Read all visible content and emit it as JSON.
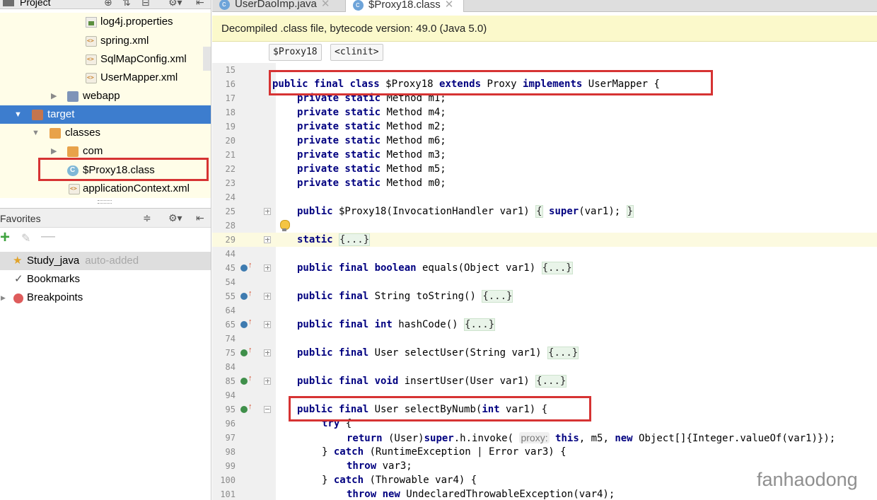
{
  "project_panel": {
    "title": "Project",
    "tree": [
      {
        "label": "log4j.properties",
        "icon": "properties-file-icon"
      },
      {
        "label": "spring.xml",
        "icon": "xml-file-icon"
      },
      {
        "label": "SqlMapConfig.xml",
        "icon": "xml-file-icon"
      },
      {
        "label": "UserMapper.xml",
        "icon": "xml-file-icon"
      },
      {
        "label": "webapp",
        "icon": "web-folder-icon"
      },
      {
        "label": "target",
        "icon": "folder-icon"
      },
      {
        "label": "classes",
        "icon": "folder-icon"
      },
      {
        "label": "com",
        "icon": "folder-icon"
      },
      {
        "label": "$Proxy18.class",
        "icon": "class-file-icon"
      },
      {
        "label": "applicationContext.xml",
        "icon": "xml-file-icon"
      }
    ]
  },
  "favorites_panel": {
    "title": "Favorites",
    "items": [
      {
        "label": "Study_java",
        "note": "auto-added",
        "icon": "star-icon"
      },
      {
        "label": "Bookmarks",
        "icon": "checkmark-icon"
      },
      {
        "label": "Breakpoints",
        "icon": "breakpoint-icon"
      }
    ]
  },
  "editor": {
    "tabs": [
      {
        "label": "UserDaoImp.java",
        "active": false
      },
      {
        "label": "$Proxy18.class",
        "active": true
      }
    ],
    "banner": "Decompiled .class file, bytecode version: 49.0 (Java 5.0)",
    "breadcrumbs": [
      "$Proxy18",
      "<clinit>"
    ],
    "line_numbers": [
      "15",
      "16",
      "17",
      "18",
      "19",
      "20",
      "21",
      "22",
      "23",
      "24",
      "25",
      "28",
      "29",
      "44",
      "45",
      "54",
      "55",
      "64",
      "65",
      "74",
      "75",
      "84",
      "85",
      "94",
      "95",
      "96",
      "97",
      "98",
      "99",
      "100",
      "101"
    ],
    "method_lines": {
      "l17": "private static Method m1;",
      "l18": "private static Method m4;",
      "l19": "private static Method m2;",
      "l20": "private static Method m6;",
      "l21": "private static Method m3;",
      "l22": "private static Method m5;",
      "l23": "private static Method m0;"
    },
    "folded_placeholder": "{...}",
    "inline_hint": "proxy:"
  },
  "watermark": "fanhaodong"
}
